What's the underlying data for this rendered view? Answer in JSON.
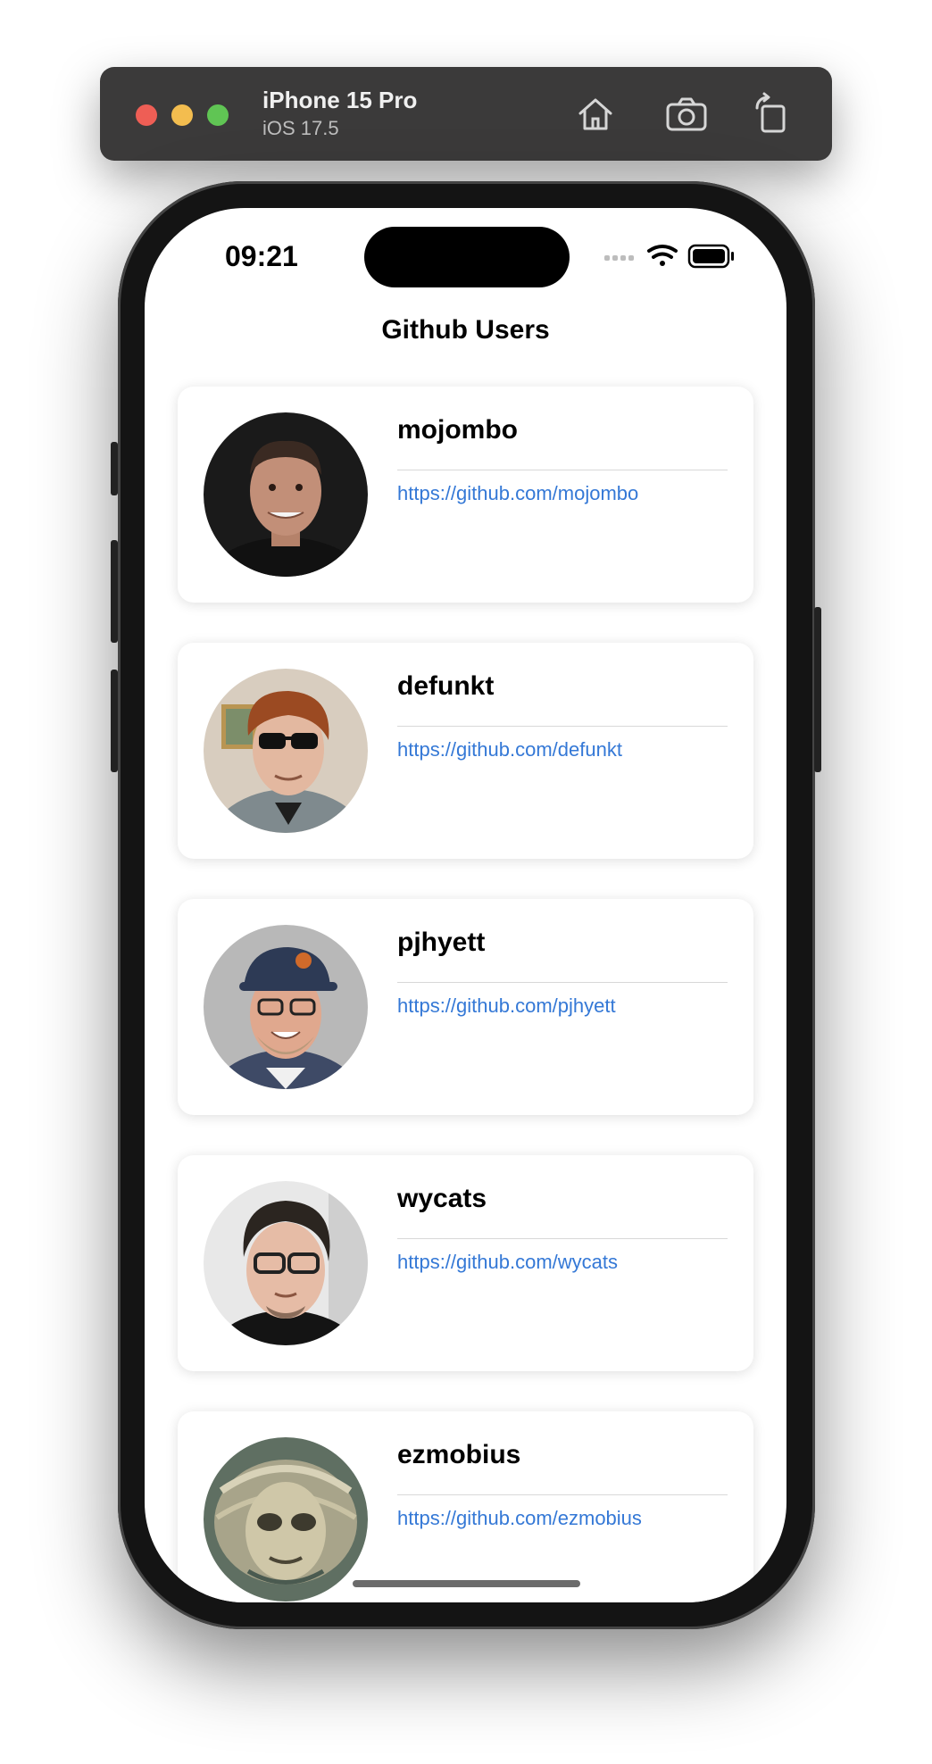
{
  "simulator": {
    "device_name": "iPhone 15 Pro",
    "os_version": "iOS 17.5",
    "buttons": [
      "home-icon",
      "camera-icon",
      "rotate-icon"
    ]
  },
  "status_bar": {
    "time": "09:21",
    "icons": [
      "signal-icon",
      "wifi-icon",
      "battery-icon"
    ]
  },
  "nav": {
    "title": "Github Users"
  },
  "users": [
    {
      "login": "mojombo",
      "url": "https://github.com/mojombo"
    },
    {
      "login": "defunkt",
      "url": "https://github.com/defunkt"
    },
    {
      "login": "pjhyett",
      "url": "https://github.com/pjhyett"
    },
    {
      "login": "wycats",
      "url": "https://github.com/wycats"
    },
    {
      "login": "ezmobius",
      "url": "https://github.com/ezmobius"
    }
  ],
  "colors": {
    "link": "#3478d6",
    "card": "#ffffff",
    "sim_bar": "#3b3a3a"
  }
}
